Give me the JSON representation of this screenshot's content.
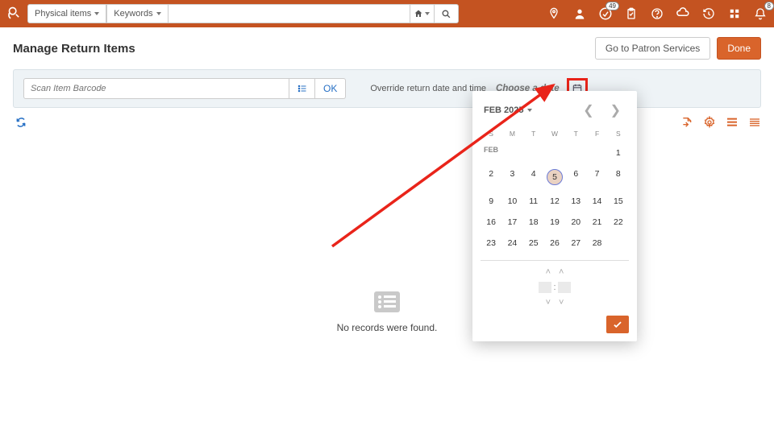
{
  "top": {
    "dropdown1": "Physical items",
    "dropdown2": "Keywords",
    "badge_tasks": "49",
    "badge_alerts": "8"
  },
  "header": {
    "title": "Manage Return Items",
    "patron_btn": "Go to Patron Services",
    "done_btn": "Done"
  },
  "toolbar": {
    "scan_placeholder": "Scan Item Barcode",
    "ok_label": "OK",
    "override_label": "Override return date and time",
    "date_placeholder": "Choose a date"
  },
  "empty": {
    "msg": "No records were found."
  },
  "calendar": {
    "month_label": "FEB 2025",
    "dow": [
      "S",
      "M",
      "T",
      "W",
      "T",
      "F",
      "S"
    ],
    "month_short": "FEB",
    "selected": 5,
    "row0": [
      "",
      "",
      "",
      "",
      "",
      "",
      "1"
    ],
    "days": [
      "2",
      "3",
      "4",
      "5",
      "6",
      "7",
      "8",
      "9",
      "10",
      "11",
      "12",
      "13",
      "14",
      "15",
      "16",
      "17",
      "18",
      "19",
      "20",
      "21",
      "22",
      "23",
      "24",
      "25",
      "26",
      "27",
      "28"
    ]
  }
}
